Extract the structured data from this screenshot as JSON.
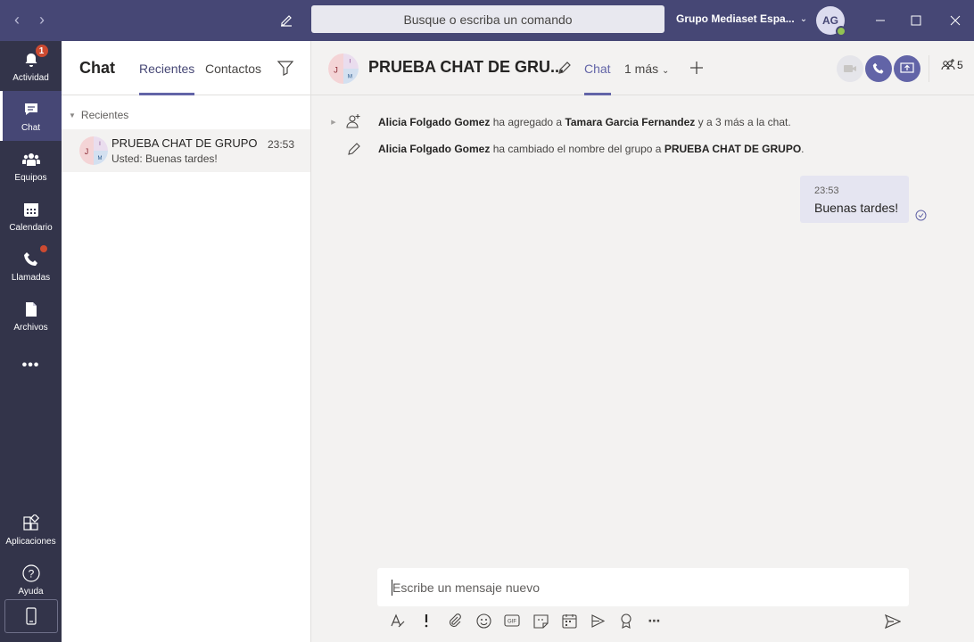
{
  "titlebar": {
    "search_placeholder": "Busque o escriba un comando",
    "org_name": "Grupo Mediaset Espa...",
    "user_initials": "AG"
  },
  "rail": {
    "items": [
      {
        "label": "Actividad",
        "icon": "bell-icon",
        "badge": "1"
      },
      {
        "label": "Chat",
        "icon": "chat-icon"
      },
      {
        "label": "Equipos",
        "icon": "teams-icon"
      },
      {
        "label": "Calendario",
        "icon": "calendar-icon"
      },
      {
        "label": "Llamadas",
        "icon": "phone-icon"
      },
      {
        "label": "Archivos",
        "icon": "file-icon"
      }
    ],
    "more": "•••",
    "apps_label": "Aplicaciones",
    "help_label": "Ayuda"
  },
  "list": {
    "title": "Chat",
    "tabs": [
      "Recientes",
      "Contactos"
    ],
    "section": "Recientes",
    "chats": [
      {
        "name": "PRUEBA CHAT DE GRUPO",
        "time": "23:53",
        "preview": "Usted: Buenas tardes!",
        "avatar_initials": [
          "J",
          "I",
          "M"
        ]
      }
    ]
  },
  "conversation": {
    "title": "PRUEBA CHAT DE GRU...",
    "avatar_initials": [
      "J",
      "I",
      "M"
    ],
    "tabs": [
      "Chat",
      "1 más"
    ],
    "participants_count": "5",
    "system_messages": [
      {
        "actor": "Alicia Folgado Gomez",
        "text1": " ha agregado a ",
        "target": "Tamara Garcia Fernandez",
        "text2": " y a 3 más a la chat."
      },
      {
        "actor": "Alicia Folgado Gomez",
        "text1": " ha cambiado el nombre del grupo a ",
        "target": "PRUEBA CHAT DE GRUPO",
        "text2": "."
      }
    ],
    "my_message": {
      "time": "23:53",
      "text": "Buenas tardes!"
    },
    "composer_placeholder": "Escribe un mensaje nuevo"
  },
  "colors": {
    "brand": "#464775",
    "accent": "#6264a7",
    "rail": "#33344a",
    "badge": "#cc4a31"
  }
}
